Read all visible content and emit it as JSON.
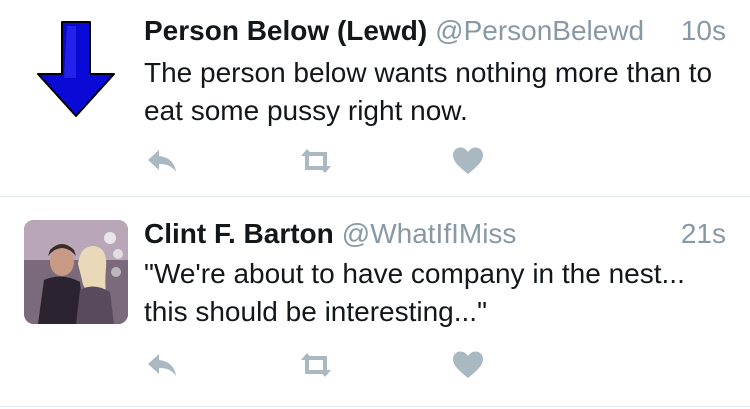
{
  "tweets": [
    {
      "name": "Person Below (Lewd)",
      "handle": "@PersonBelewd",
      "time": "10s",
      "text": "The person below wants nothing more than to eat some pussy right now.",
      "avatar_icon": "down-arrow-icon",
      "avatar_color": "#0a0ad6"
    },
    {
      "name": "Clint F. Barton",
      "handle": "@WhatIfIMiss",
      "time": "21s",
      "text": "\"We're about to have company in the nest... this should be interesting...\"",
      "avatar_icon": "profile-photo"
    }
  ],
  "actions": {
    "reply_icon": "reply-icon",
    "retweet_icon": "retweet-icon",
    "like_icon": "heart-icon",
    "icon_color": "#aab8c2"
  },
  "colors": {
    "text": "#14171a",
    "secondary": "#8899a6",
    "divider": "#e1e8ed"
  }
}
